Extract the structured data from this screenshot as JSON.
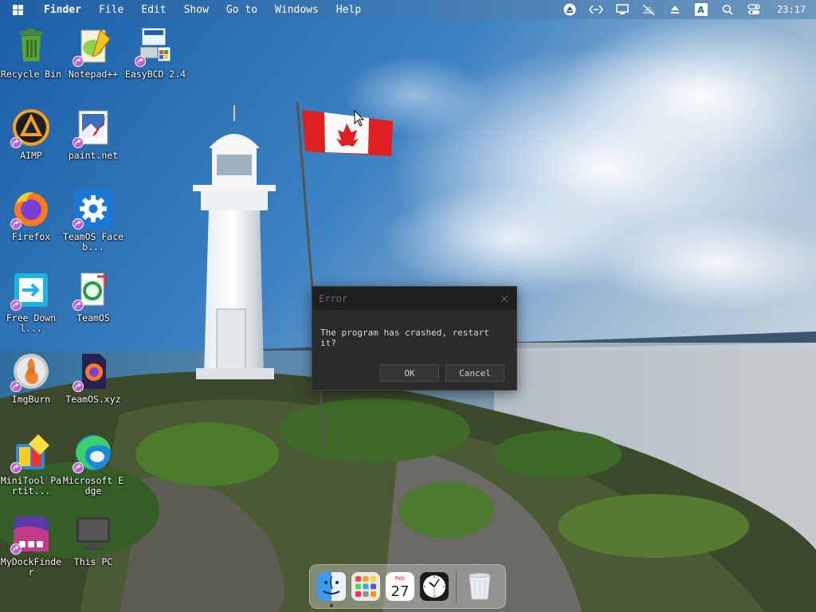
{
  "menubar": {
    "app_name": "Finder",
    "items": [
      "File",
      "Edit",
      "Show",
      "Go to",
      "Windows",
      "Help"
    ],
    "status_icons": [
      "eject-icon",
      "code-icon",
      "display-icon",
      "network-off-icon",
      "upload-icon",
      "input-method-icon",
      "search-icon",
      "control-center-icon"
    ],
    "input_method_letter": "A",
    "clock": "23:17"
  },
  "desktop_icons": [
    {
      "label": "Recycle Bin",
      "icon": "recycle-bin-icon"
    },
    {
      "label": "Notepad++",
      "icon": "notepad-plus-plus-icon"
    },
    {
      "label": "EasyBCD 2.4",
      "icon": "easybcd-icon"
    },
    {
      "label": "AIMP",
      "icon": "aimp-icon"
    },
    {
      "label": "paint.net",
      "icon": "paint-net-icon"
    },
    {
      "label": "Firefox",
      "icon": "firefox-icon"
    },
    {
      "label": "TeamOS Faceb...",
      "icon": "gear-icon"
    },
    {
      "label": "Free Downl...",
      "icon": "free-download-manager-icon"
    },
    {
      "label": "TeamOS",
      "icon": "teamos-icon"
    },
    {
      "label": "ImgBurn",
      "icon": "imgburn-icon"
    },
    {
      "label": "TeamOS.xyz",
      "icon": "teamos-xyz-icon"
    },
    {
      "label": "MiniTool Partit...",
      "icon": "minitool-partition-icon"
    },
    {
      "label": "Microsoft Edge",
      "icon": "edge-icon"
    },
    {
      "label": "MyDockFinder",
      "icon": "mydockfinder-icon"
    },
    {
      "label": "This PC",
      "icon": "this-pc-icon"
    }
  ],
  "dialog": {
    "title": "Error",
    "message": "The program has crashed, restart it?",
    "ok_label": "OK",
    "cancel_label": "Cancel"
  },
  "dock": {
    "items": [
      "finder-icon",
      "launchpad-icon",
      "calendar-icon",
      "clock-icon",
      "trash-icon"
    ],
    "calendar_month": "Feb",
    "calendar_day": "27"
  },
  "colors": {
    "menubar_start": "#1f5fa3",
    "dialog_bg": "#2b2b2b",
    "dialog_title_bg": "#1f1f1f",
    "shortcut_badge": "#c45bd6"
  }
}
